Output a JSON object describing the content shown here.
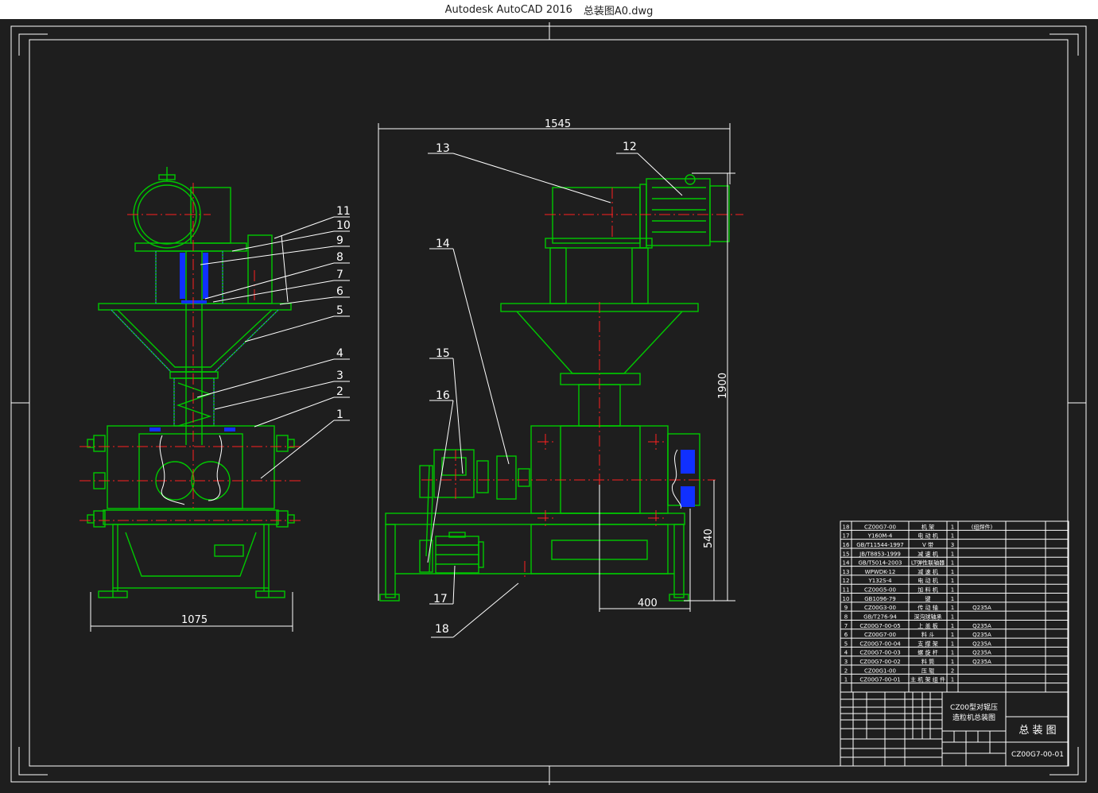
{
  "window": {
    "app": "Autodesk AutoCAD 2016",
    "file": "总装图A0.dwg"
  },
  "colors": {
    "background": "#1e1e1e",
    "green": "#00c800",
    "red": "#ff2020",
    "white": "#ffffff",
    "blue": "#1030ff"
  },
  "dimensions": {
    "left_width": "1075",
    "top_width": "1545",
    "height_total": "1900",
    "height_lower": "540",
    "offset": "400"
  },
  "left_labels": [
    "11",
    "10",
    "9",
    "8",
    "7",
    "6",
    "5",
    "4",
    "3",
    "2",
    "1"
  ],
  "right_labels": {
    "l12": "12",
    "l13": "13",
    "l14": "14",
    "l15": "15",
    "l16": "16",
    "l17": "17",
    "l18": "18"
  },
  "bom": [
    {
      "no": "18",
      "code": "CZ00G7-00",
      "name": "机 架",
      "qty": "1",
      "material": "(组焊件)",
      "note": ""
    },
    {
      "no": "17",
      "code": "Y160M-4",
      "name": "电 动 机",
      "qty": "1",
      "material": "",
      "note": ""
    },
    {
      "no": "16",
      "code": "GB/T11544-1997",
      "name": "V 带",
      "qty": "3",
      "material": "",
      "note": ""
    },
    {
      "no": "15",
      "code": "JB/T8853-1999",
      "name": "减 速 机",
      "qty": "1",
      "material": "",
      "note": ""
    },
    {
      "no": "14",
      "code": "GB/T5014-2003",
      "name": "LT弹性联轴器",
      "qty": "1",
      "material": "",
      "note": ""
    },
    {
      "no": "13",
      "code": "WPWDK-12",
      "name": "减 速 机",
      "qty": "1",
      "material": "",
      "note": ""
    },
    {
      "no": "12",
      "code": "Y132S-4",
      "name": "电 动 机",
      "qty": "1",
      "material": "",
      "note": ""
    },
    {
      "no": "11",
      "code": "CZ00G5-00",
      "name": "加 料 机",
      "qty": "1",
      "material": "",
      "note": ""
    },
    {
      "no": "10",
      "code": "GB1096-79",
      "name": "键",
      "qty": "1",
      "material": "",
      "note": ""
    },
    {
      "no": "9",
      "code": "CZ00G3-00",
      "name": "传 动 轴",
      "qty": "1",
      "material": "Q235A",
      "note": ""
    },
    {
      "no": "8",
      "code": "GB/T276-94",
      "name": "深沟球轴承",
      "qty": "1",
      "material": "",
      "note": ""
    },
    {
      "no": "7",
      "code": "CZ00G7-00-05",
      "name": "上 盖 板",
      "qty": "1",
      "material": "Q235A",
      "note": ""
    },
    {
      "no": "6",
      "code": "CZ00G7-00",
      "name": "料 斗",
      "qty": "1",
      "material": "Q235A",
      "note": ""
    },
    {
      "no": "5",
      "code": "CZ00G7-00-04",
      "name": "支 撑 架",
      "qty": "1",
      "material": "Q235A",
      "note": ""
    },
    {
      "no": "4",
      "code": "CZ00G7-00-03",
      "name": "螺 旋 杆",
      "qty": "1",
      "material": "Q235A",
      "note": ""
    },
    {
      "no": "3",
      "code": "CZ00G7-00-02",
      "name": "料 筒",
      "qty": "1",
      "material": "Q235A",
      "note": ""
    },
    {
      "no": "2",
      "code": "CZ00G1-00",
      "name": "压 辊",
      "qty": "2",
      "material": "",
      "note": ""
    },
    {
      "no": "1",
      "code": "CZ00G7-00-01",
      "name": "主 机 架 组 件",
      "qty": "1",
      "material": "",
      "note": ""
    }
  ],
  "title_block": {
    "project_line1": "CZ00型对辊压",
    "project_line2": "造粒机总装图",
    "drawing_name": "总 装 图",
    "drawing_no": "CZ00G7-00-01"
  }
}
